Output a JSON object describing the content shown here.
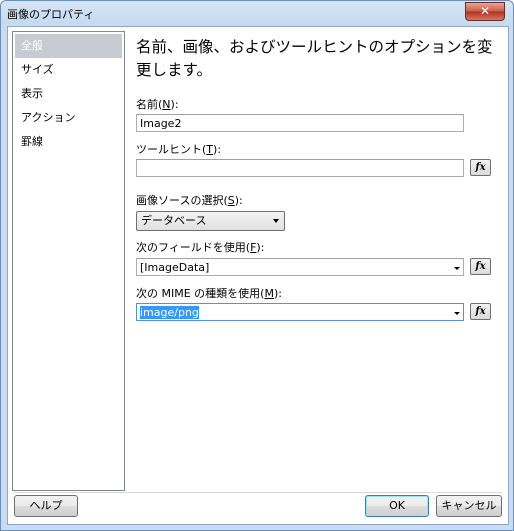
{
  "window": {
    "title": "画像のプロパティ",
    "close_glyph": "✕"
  },
  "sidebar": {
    "items": [
      {
        "label": "全般",
        "selected": true
      },
      {
        "label": "サイズ"
      },
      {
        "label": "表示"
      },
      {
        "label": "アクション"
      },
      {
        "label": "罫線"
      }
    ]
  },
  "main": {
    "heading": "名前、画像、およびツールヒントのオプションを変更します。",
    "name": {
      "label": "名前(",
      "access": "N",
      "suffix": "):",
      "value": "Image2"
    },
    "tooltip": {
      "label": "ツールヒント(",
      "access": "T",
      "suffix": "):",
      "value": ""
    },
    "image_source": {
      "label": "画像ソースの選択(",
      "access": "S",
      "suffix": "):",
      "value": "データベース"
    },
    "field": {
      "label": "次のフィールドを使用(",
      "access": "F",
      "suffix": "):",
      "value": "[ImageData]"
    },
    "mime": {
      "label": "次の MIME の種類を使用(",
      "access": "M",
      "suffix": "):",
      "value": "image/png"
    },
    "fx_label": "fx"
  },
  "footer": {
    "help": "ヘルプ",
    "ok": "OK",
    "cancel": "キャンセル"
  }
}
